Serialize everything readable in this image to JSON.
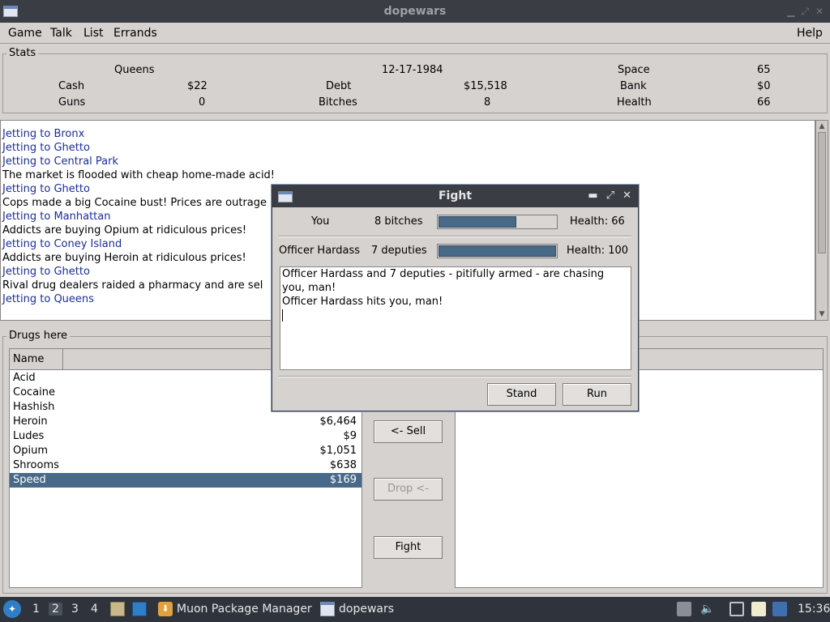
{
  "window": {
    "title": "dopewars"
  },
  "menu": {
    "game": "Game",
    "talk": "Talk",
    "list": "List",
    "errands": "Errands",
    "help": "Help"
  },
  "stats": {
    "legend": "Stats",
    "location": "Queens",
    "date": "12-17-1984",
    "space_label": "Space",
    "space_value": "65",
    "cash_label": "Cash",
    "cash_value": "$22",
    "debt_label": "Debt",
    "debt_value": "$15,518",
    "bank_label": "Bank",
    "bank_value": "$0",
    "guns_label": "Guns",
    "guns_value": "0",
    "bitches_label": "Bitches",
    "bitches_value": "8",
    "health_label": "Health",
    "health_value": "66"
  },
  "messages": [
    {
      "text": "Jetting to Bronx",
      "travel": true
    },
    {
      "text": "Jetting to Ghetto",
      "travel": true
    },
    {
      "text": "Jetting to Central Park",
      "travel": true
    },
    {
      "text": "The market is flooded with cheap home-made acid!",
      "travel": false
    },
    {
      "text": "Jetting to Ghetto",
      "travel": true
    },
    {
      "text": "Cops made a big Cocaine bust! Prices are outrage",
      "travel": false
    },
    {
      "text": "Jetting to Manhattan",
      "travel": true
    },
    {
      "text": "Addicts are buying Opium at ridiculous prices!",
      "travel": false
    },
    {
      "text": "Jetting to Coney Island",
      "travel": true
    },
    {
      "text": "Addicts are buying Heroin at ridiculous prices!",
      "travel": false
    },
    {
      "text": "Jetting to Ghetto",
      "travel": true
    },
    {
      "text": "Rival drug dealers raided a pharmacy and are sel",
      "travel": false
    },
    {
      "text": "Jetting to Queens",
      "travel": true
    }
  ],
  "drugs": {
    "legend": "Drugs here",
    "column_name": "Name",
    "items": [
      {
        "name": "Acid",
        "price": ""
      },
      {
        "name": "Cocaine",
        "price": ""
      },
      {
        "name": "Hashish",
        "price": ""
      },
      {
        "name": "Heroin",
        "price": "$6,464"
      },
      {
        "name": "Ludes",
        "price": "$9"
      },
      {
        "name": "Opium",
        "price": "$1,051"
      },
      {
        "name": "Shrooms",
        "price": "$638"
      },
      {
        "name": "Speed",
        "price": "$169"
      }
    ],
    "selected_index": 7
  },
  "actions": {
    "sell": "<- Sell",
    "drop": "Drop <-",
    "fight": "Fight"
  },
  "fight_dialog": {
    "title": "Fight",
    "you_label": "You",
    "you_count": "8 bitches",
    "you_health": "Health: 66",
    "you_health_fraction": 0.66,
    "enemy_label": "Officer Hardass",
    "enemy_count": "7 deputies",
    "enemy_health": "Health: 100",
    "enemy_health_fraction": 1.0,
    "log_line1": "Officer Hardass and 7 deputies - pitifully armed - are chasing",
    "log_line2": "you, man!",
    "log_line3": "Officer Hardass hits you, man!",
    "stand_label": "Stand",
    "run_label": "Run"
  },
  "taskbar": {
    "workspaces": [
      "1",
      "2",
      "3",
      "4"
    ],
    "active_workspace": "2",
    "muon": "Muon Package Manager",
    "dopewars": "dopewars",
    "clock": "15:36"
  }
}
